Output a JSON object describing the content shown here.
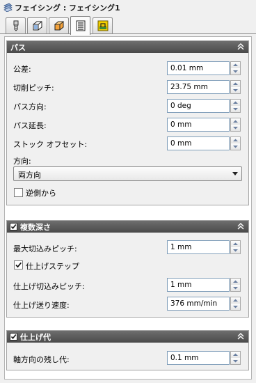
{
  "window": {
    "title": "フェイシング : フェイシング1"
  },
  "tabs": [
    {
      "icon": "tool-icon"
    },
    {
      "icon": "geometry-icon"
    },
    {
      "icon": "heights-icon"
    },
    {
      "icon": "passes-icon"
    },
    {
      "icon": "linking-icon"
    }
  ],
  "active_tab_index": 3,
  "passes": {
    "header": "パス",
    "tolerance": {
      "label": "公差:",
      "value": "0.01 mm"
    },
    "stepover": {
      "label": "切削ピッチ:",
      "value": "23.75 mm"
    },
    "pass_direction": {
      "label": "パス方向:",
      "value": "0 deg"
    },
    "pass_extension": {
      "label": "パス延長:",
      "value": "0 mm"
    },
    "stock_offset": {
      "label": "ストック オフセット:",
      "value": "0 mm"
    },
    "direction": {
      "label": "方向:",
      "selected": "両方向"
    },
    "opposite_side": {
      "label": "逆側から",
      "checked": false
    }
  },
  "multiple_depths": {
    "header": "複数深さ",
    "checked": true,
    "max_stepdown": {
      "label": "最大切込みピッチ:",
      "value": "1 mm"
    },
    "finishing_stepdowns": {
      "label": "仕上げステップ",
      "checked": true
    },
    "finishing_stepdown": {
      "label": "仕上げ切込みピッチ:",
      "value": "1 mm"
    },
    "finishing_feedrate": {
      "label": "仕上げ送り速度:",
      "value": "376 mm/min"
    }
  },
  "stock_to_leave": {
    "header": "仕上げ代",
    "checked": true,
    "axial": {
      "label": "軸方向の残し代:",
      "value": "0.1 mm"
    }
  }
}
